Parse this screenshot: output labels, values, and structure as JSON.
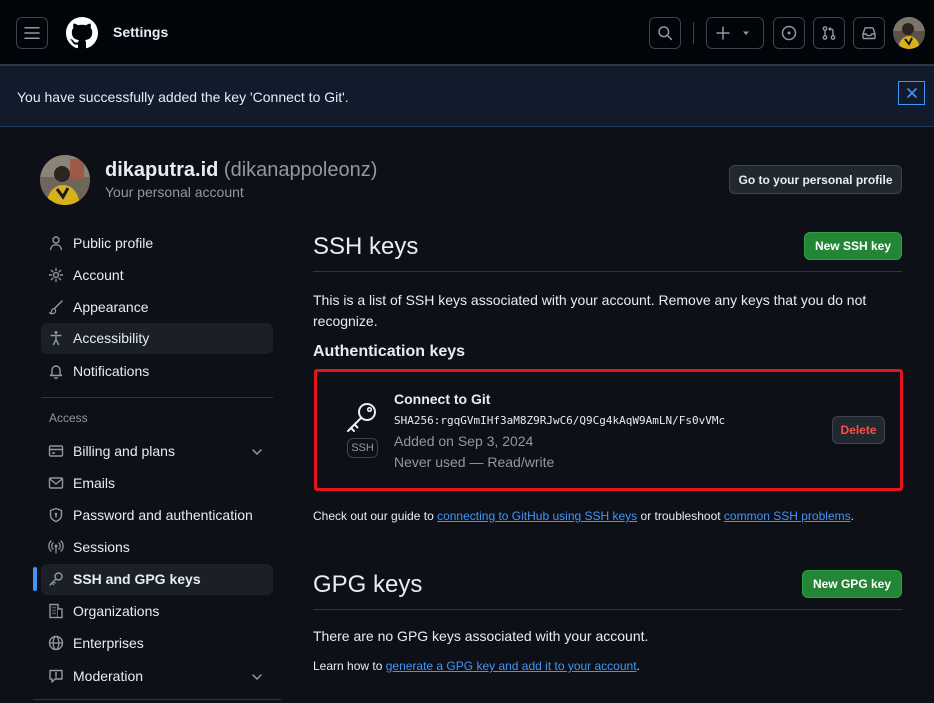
{
  "header": {
    "title": "Settings",
    "icons": {
      "menu": "hamburger-icon",
      "logo": "github-logo",
      "search": "search-icon",
      "create": "plus-icon",
      "issues": "issue-opened-icon",
      "pull_requests": "git-pull-request-icon",
      "inbox": "inbox-icon"
    }
  },
  "flash": {
    "message": "You have successfully added the key 'Connect to Git'.",
    "close_icon": "x-icon"
  },
  "profile": {
    "display_name": "dikaputra.id",
    "username": "(dikanappoleonz)",
    "subtitle": "Your personal account",
    "go_profile_label": "Go to your personal profile"
  },
  "sidebar": {
    "items": [
      {
        "label": "Public profile",
        "icon": "person-icon"
      },
      {
        "label": "Account",
        "icon": "gear-icon"
      },
      {
        "label": "Appearance",
        "icon": "paintbrush-icon"
      },
      {
        "label": "Accessibility",
        "icon": "accessibility-icon"
      },
      {
        "label": "Notifications",
        "icon": "bell-icon"
      }
    ],
    "section_label": "Access",
    "access_items": [
      {
        "label": "Billing and plans",
        "icon": "credit-card-icon"
      },
      {
        "label": "Emails",
        "icon": "mail-icon"
      },
      {
        "label": "Password and authentication",
        "icon": "shield-lock-icon"
      },
      {
        "label": "Sessions",
        "icon": "broadcast-icon"
      },
      {
        "label": "SSH and GPG keys",
        "icon": "key-icon"
      },
      {
        "label": "Organizations",
        "icon": "organization-icon"
      },
      {
        "label": "Enterprises",
        "icon": "globe-icon"
      },
      {
        "label": "Moderation",
        "icon": "report-icon"
      }
    ]
  },
  "ssh": {
    "heading": "SSH keys",
    "new_button": "New SSH key",
    "intro": "This is a list of SSH keys associated with your account. Remove any keys that you do not recognize.",
    "auth_heading": "Authentication keys",
    "key": {
      "title": "Connect to Git",
      "fingerprint": "SHA256:rgqGVmIHf3aM8Z9RJwC6/Q9Cg4kAqW9AmLN/Fs0vVMc",
      "added": "Added on Sep 3, 2024",
      "usage": "Never used — Read/write",
      "badge": "SSH",
      "delete_label": "Delete"
    },
    "guide_prefix": "Check out our guide to ",
    "guide_link1": "connecting to GitHub using SSH keys",
    "guide_mid": " or troubleshoot ",
    "guide_link2": "common SSH problems",
    "guide_suffix": "."
  },
  "gpg": {
    "heading": "GPG keys",
    "new_button": "New GPG key",
    "empty": "There are no GPG keys associated with your account.",
    "learn_prefix": "Learn how to ",
    "learn_link": "generate a GPG key and add it to your account",
    "learn_suffix": "."
  },
  "colors": {
    "background": "#0d1117",
    "header_bg": "#010409",
    "accent_blue": "#4493f8",
    "green_button": "#238636",
    "danger": "#f85149",
    "highlight_box": "#e5141b"
  }
}
